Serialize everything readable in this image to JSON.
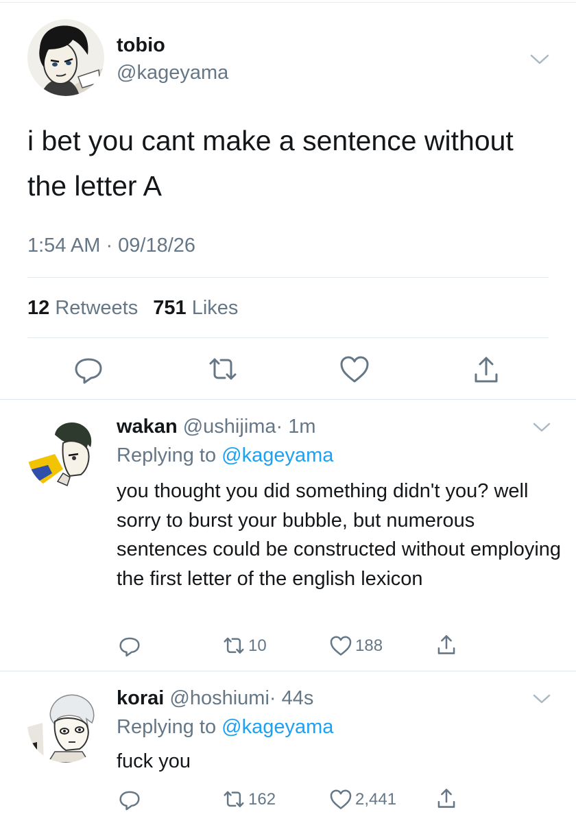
{
  "main_tweet": {
    "display_name": "tobio",
    "handle": "@kageyama",
    "text": "i bet you cant make a sentence without the letter A",
    "timestamp": "1:54 AM · 09/18/26",
    "retweet_count": "12",
    "retweet_label": "Retweets",
    "like_count": "751",
    "like_label": "Likes",
    "actions": [
      "reply-icon",
      "retweet-icon",
      "like-icon",
      "share-icon"
    ]
  },
  "replies": [
    {
      "display_name": "wakan",
      "handle": "@ushijima",
      "time": "· 1m",
      "replying_prefix": "Replying to",
      "replying_to": "@kageyama",
      "text": "you thought you did something didn't you? well sorry to burst your bubble, but numerous sentences could be constructed without employing the first letter of the english lexicon",
      "retweets": "10",
      "likes": "188"
    },
    {
      "display_name": "korai",
      "handle": "@hoshiumi",
      "time": "· 44s",
      "replying_prefix": "Replying to",
      "replying_to": "@kageyama",
      "text": "fuck you",
      "retweets": "162",
      "likes": "2,441"
    }
  ],
  "colors": {
    "link_blue": "#1da1f2",
    "secondary_gray": "#657786",
    "primary_text": "#14171a",
    "divider": "#e1e8ed"
  }
}
